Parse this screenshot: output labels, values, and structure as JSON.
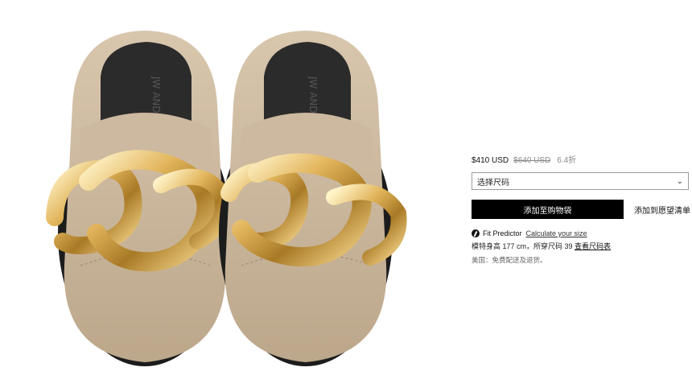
{
  "product": {
    "price_current": "$410 USD",
    "price_original": "$640 USD",
    "discount": "6.4折",
    "size_select": {
      "placeholder": "选择尺码",
      "icon": "chevron-down-icon"
    },
    "add_to_cart": "添加至购物袋",
    "add_to_wishlist": "添加到愿望清单",
    "fit_predictor": {
      "icon": "fit-predictor-icon",
      "title": "Fit Predictor",
      "link": "Calculate your size"
    },
    "model_info": {
      "text": "模特身高 177 cm，所穿尺码 39 ",
      "size_chart_link": "查看尺码表"
    },
    "shipping_note": "美国：免费配送及退货。",
    "insole_brand": "JW ANDERSON"
  },
  "colors": {
    "suede": "#c9b49a",
    "gold": "#d9ae5a",
    "button": "#000000"
  }
}
